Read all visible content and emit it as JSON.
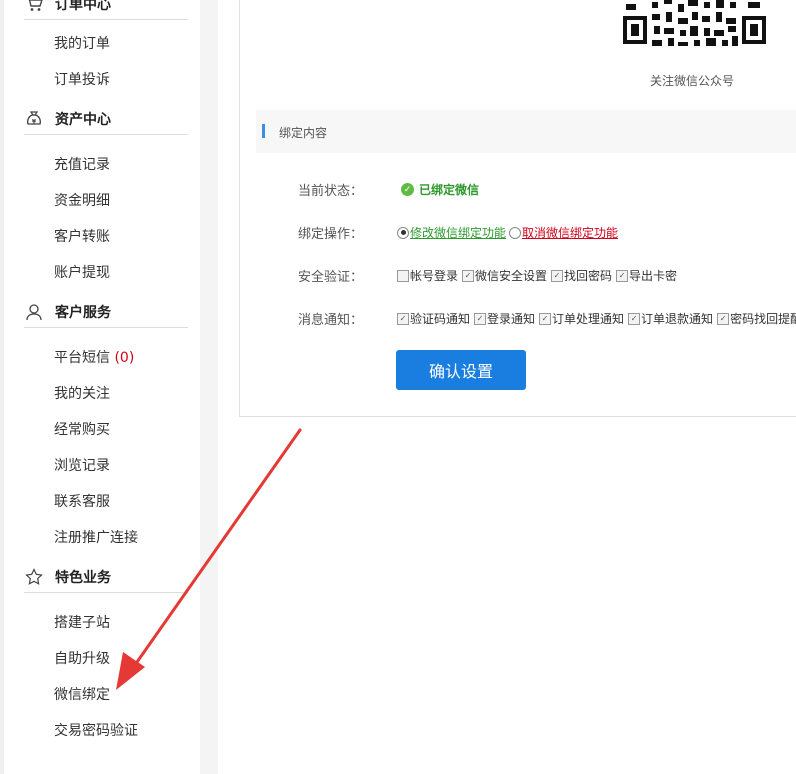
{
  "sidebar": {
    "groups": [
      {
        "title": "订单中心",
        "icon": "cart-icon",
        "items": [
          {
            "label": "我的订单"
          },
          {
            "label": "订单投诉"
          }
        ]
      },
      {
        "title": "资产中心",
        "icon": "money-bag-icon",
        "items": [
          {
            "label": "充值记录"
          },
          {
            "label": "资金明细"
          },
          {
            "label": "客户转账"
          },
          {
            "label": "账户提现"
          }
        ]
      },
      {
        "title": "客户服务",
        "icon": "user-icon",
        "items": [
          {
            "label": "平台短信 ",
            "count": "(0)"
          },
          {
            "label": "我的关注"
          },
          {
            "label": "经常购买"
          },
          {
            "label": "浏览记录"
          },
          {
            "label": "联系客服"
          },
          {
            "label": "注册推广连接"
          }
        ]
      },
      {
        "title": "特色业务",
        "icon": "star-icon",
        "items": [
          {
            "label": "搭建子站"
          },
          {
            "label": "自助升级"
          },
          {
            "label": "微信绑定"
          },
          {
            "label": "交易密码验证"
          }
        ]
      }
    ]
  },
  "main": {
    "qr_caption": "关注微信公众号",
    "section_title": "绑定内容",
    "status_label": "当前状态：",
    "status_value": "已绑定微信",
    "operation_label": "绑定操作：",
    "operation_options": [
      {
        "label": "修改微信绑定功能",
        "selected": true
      },
      {
        "label": "取消微信绑定功能",
        "selected": false
      }
    ],
    "security_label": "安全验证：",
    "security_options": [
      {
        "label": "帐号登录",
        "checked": false
      },
      {
        "label": "微信安全设置",
        "checked": true
      },
      {
        "label": "找回密码",
        "checked": true
      },
      {
        "label": "导出卡密",
        "checked": true
      }
    ],
    "notify_label": "消息通知：",
    "notify_options": [
      {
        "label": "验证码通知",
        "checked": true
      },
      {
        "label": "登录通知",
        "checked": true
      },
      {
        "label": "订单处理通知",
        "checked": true
      },
      {
        "label": "订单退款通知",
        "checked": true
      },
      {
        "label": "密码找回提醒",
        "checked": true
      }
    ],
    "confirm_label": "确认设置"
  },
  "colors": {
    "accent": "#1a7ee0",
    "status_green": "#2e9a2e",
    "link_red": "#d0021b",
    "arrow": "#e53935"
  }
}
